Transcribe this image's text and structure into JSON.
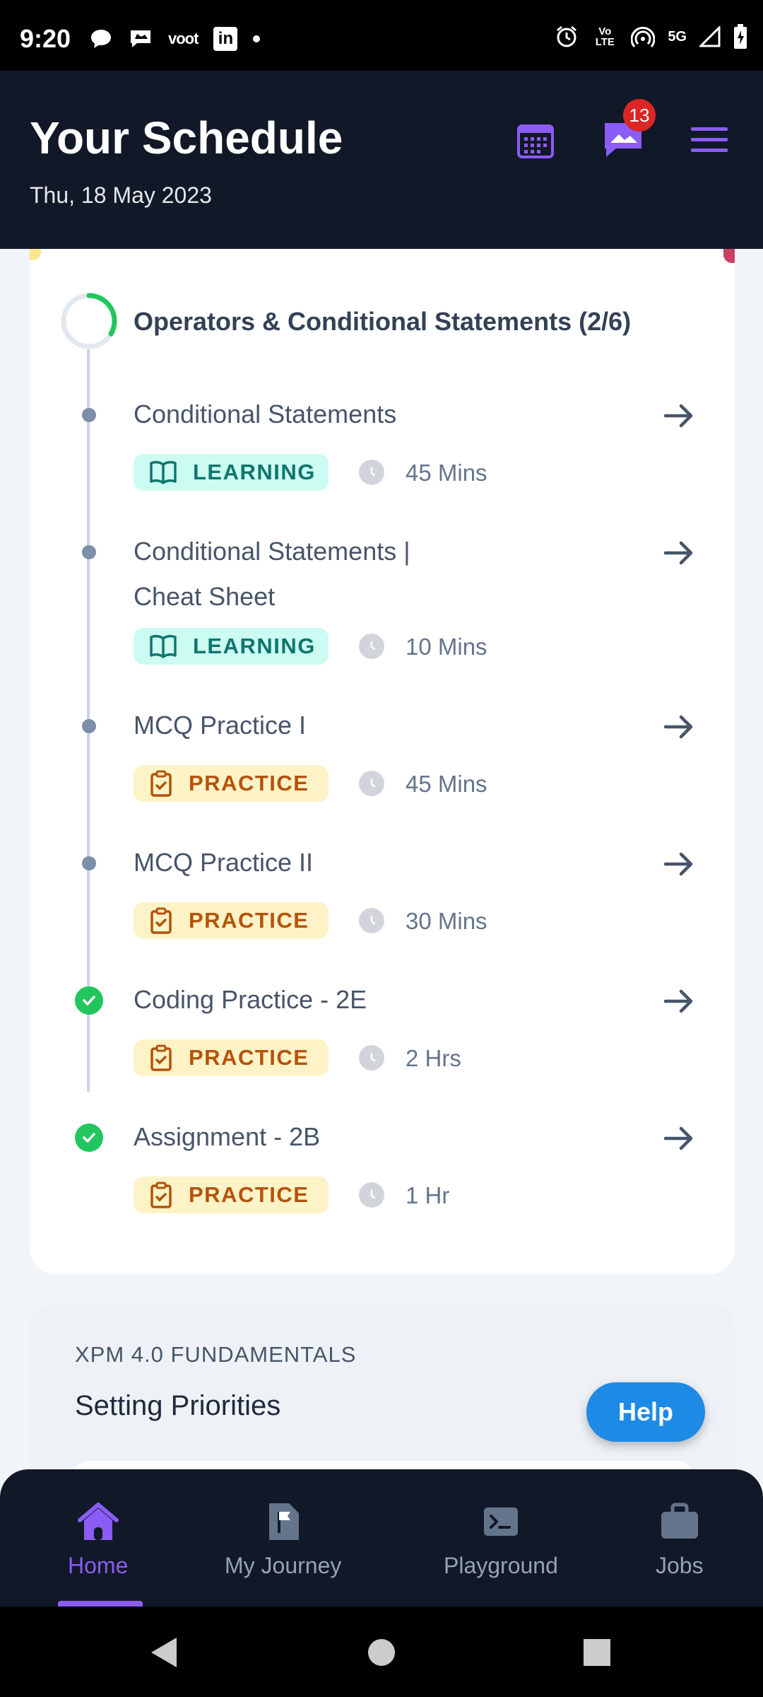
{
  "status_bar": {
    "time": "9:20",
    "left_icons": [
      "chat-icon",
      "flag-message-icon",
      "voot-icon",
      "linkedin-icon",
      "dot-icon"
    ],
    "voot_text": "voot",
    "linkedin_text": "in",
    "network_text": "Vo LTE",
    "signal_text": "5G",
    "right_icons": [
      "alarm-icon",
      "volte-icon",
      "hotspot-icon",
      "5g-icon",
      "signal-icon",
      "battery-icon"
    ]
  },
  "header": {
    "title": "Your Schedule",
    "date": "Thu, 18 May 2023",
    "notification_count": "13"
  },
  "module": {
    "title": "Operators & Conditional Statements (2/6)",
    "progress_completed": 2,
    "progress_total": 6,
    "items": [
      {
        "title": "Conditional Statements",
        "tag": "LEARNING",
        "duration": "45 Mins",
        "completed": false
      },
      {
        "title": "Conditional Statements | Cheat Sheet",
        "tag": "LEARNING",
        "duration": "10 Mins",
        "completed": false
      },
      {
        "title": "MCQ Practice I",
        "tag": "PRACTICE",
        "duration": "45 Mins",
        "completed": false
      },
      {
        "title": "MCQ Practice II",
        "tag": "PRACTICE",
        "duration": "30 Mins",
        "completed": false
      },
      {
        "title": "Coding Practice - 2E",
        "tag": "PRACTICE",
        "duration": "2 Hrs",
        "completed": true
      },
      {
        "title": "Assignment - 2B",
        "tag": "PRACTICE",
        "duration": "1 Hr",
        "completed": true
      }
    ]
  },
  "next_module": {
    "kicker": "XPM 4.0 FUNDAMENTALS",
    "title": "Setting Priorities"
  },
  "help_label": "Help",
  "bottom_nav": [
    {
      "label": "Home",
      "icon": "home-icon",
      "active": true
    },
    {
      "label": "My Journey",
      "icon": "journey-flag-icon",
      "active": false
    },
    {
      "label": "Playground",
      "icon": "terminal-icon",
      "active": false
    },
    {
      "label": "Jobs",
      "icon": "briefcase-icon",
      "active": false
    }
  ],
  "colors": {
    "header_bg": "#111827",
    "accent": "#8b5cf6",
    "learning_bg": "#ccfbf1",
    "learning_fg": "#0f766e",
    "practice_bg": "#fef3c7",
    "practice_fg": "#b45309",
    "done": "#22c55e",
    "help": "#1d8ae6"
  }
}
